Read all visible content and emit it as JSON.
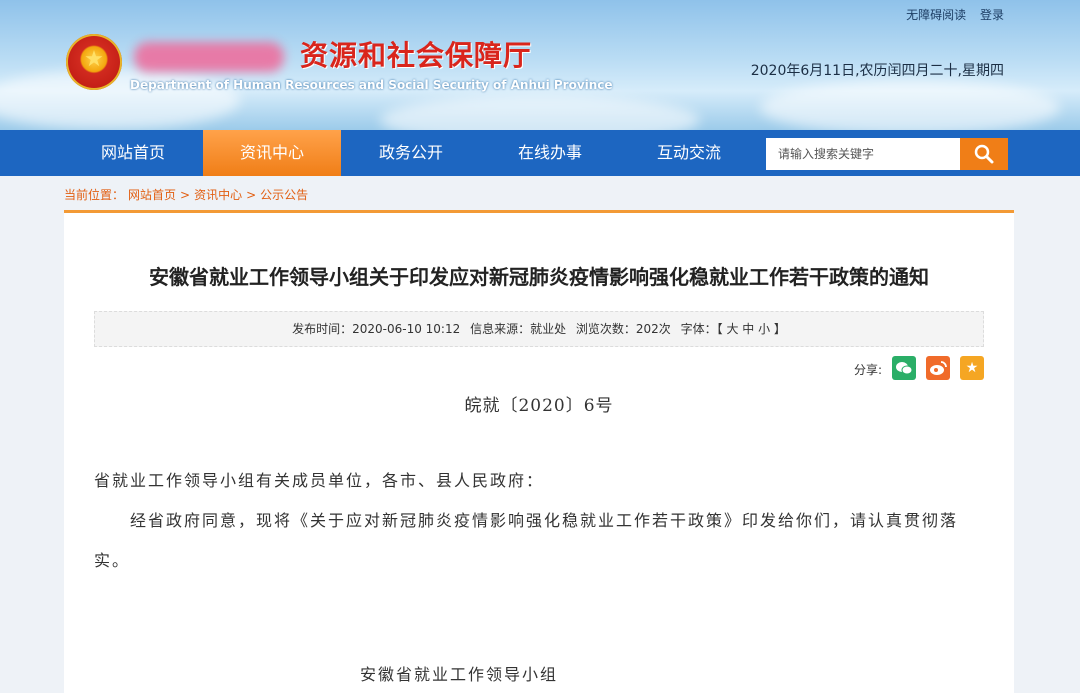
{
  "header": {
    "top_links": [
      "无障碍阅读",
      "登录"
    ],
    "site_title": "资源和社会保障厅",
    "site_subtitle": "Department of Human Resources and Social Security of Anhui Province",
    "date": "2020年6月11日,农历闰四月二十,星期四"
  },
  "nav": {
    "items": [
      "网站首页",
      "资讯中心",
      "政务公开",
      "在线办事",
      "互动交流"
    ],
    "active_index": 1,
    "search_placeholder": "请输入搜索关键字"
  },
  "breadcrumb": {
    "prefix": "当前位置：",
    "items": [
      "网站首页",
      "资讯中心",
      "公示公告"
    ],
    "separator": ">"
  },
  "article": {
    "title": "安徽省就业工作领导小组关于印发应对新冠肺炎疫情影响强化稳就业工作若干政策的通知",
    "meta": {
      "publish_time": "发布时间：2020-06-10 10:12",
      "source": "信息来源：就业处",
      "views": "浏览次数：202次",
      "font_size": "字体：【 大 中 小 】"
    },
    "share_label": "分享:",
    "doc_number": "皖就〔2020〕6号",
    "addressee": "省就业工作领导小组有关成员单位，各市、县人民政府：",
    "paragraph": "经省政府同意，现将《关于应对新冠肺炎疫情影响强化稳就业工作若干政策》印发给你们，请认真贯彻落实。",
    "signature": "安徽省就业工作领导小组"
  },
  "colors": {
    "nav_blue": "#1d66c1",
    "active_orange": "#f07e17",
    "title_red": "#d9251c",
    "wechat_green": "#2aae67",
    "weibo_orange": "#f06b2a",
    "favorite_orange": "#f5a623"
  },
  "icons": [
    "emblem-icon",
    "search-icon",
    "wechat-icon",
    "weibo-icon",
    "star-icon"
  ]
}
